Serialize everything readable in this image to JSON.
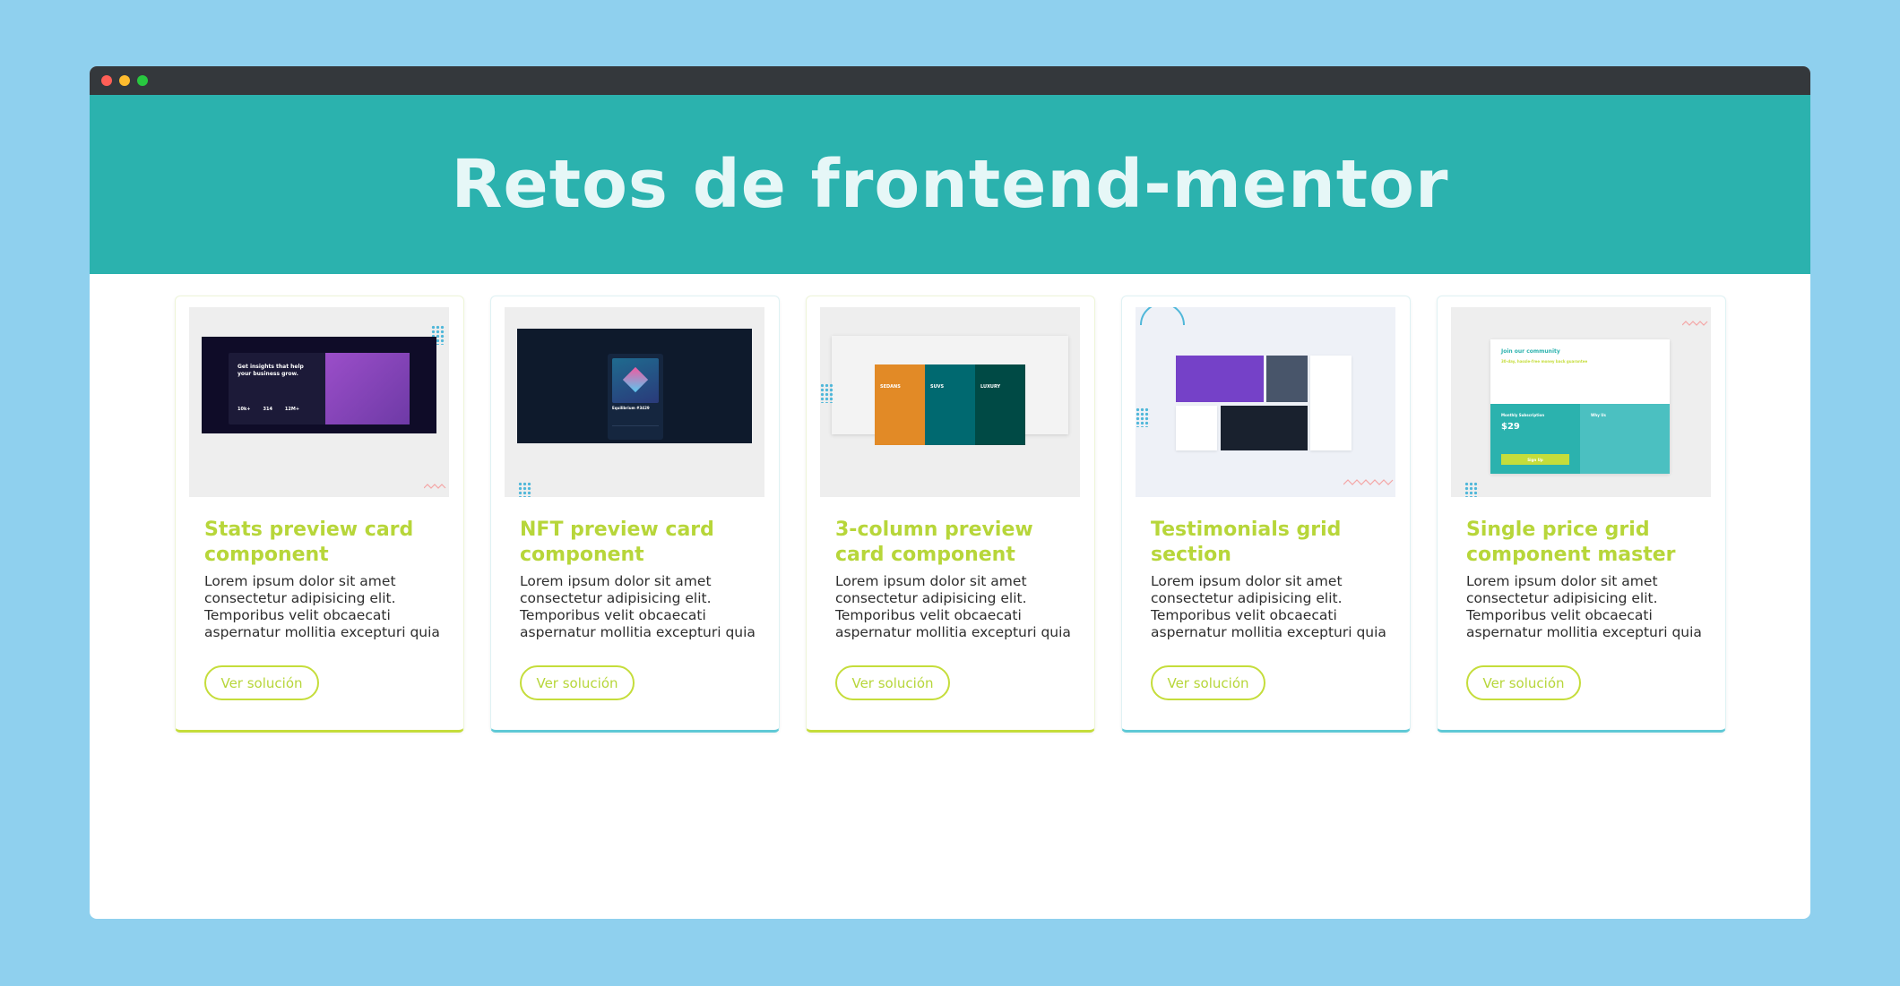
{
  "window": {
    "title_bar": {
      "dots": [
        "close",
        "minimize",
        "maximize"
      ]
    }
  },
  "hero": {
    "title": "Retos de frontend-mentor"
  },
  "cards": [
    {
      "title": "Stats preview card component",
      "description": "Lorem ipsum dolor sit amet consectetur adipisicing elit. Temporibus velit obcaecati aspernatur mollitia excepturi quia",
      "button": "Ver solución",
      "accent": "lime"
    },
    {
      "title": "NFT preview card component",
      "description": "Lorem ipsum dolor sit amet consectetur adipisicing elit. Temporibus velit obcaecati aspernatur mollitia excepturi quia",
      "button": "Ver solución",
      "accent": "teal"
    },
    {
      "title": "3-column preview card component",
      "description": "Lorem ipsum dolor sit amet consectetur adipisicing elit. Temporibus velit obcaecati aspernatur mollitia excepturi quia",
      "button": "Ver solución",
      "accent": "lime"
    },
    {
      "title": "Testimonials grid section",
      "description": "Lorem ipsum dolor sit amet consectetur adipisicing elit. Temporibus velit obcaecati aspernatur mollitia excepturi quia",
      "button": "Ver solución",
      "accent": "teal"
    },
    {
      "title": "Single price grid component master",
      "description": "Lorem ipsum dolor sit amet consectetur adipisicing elit. Temporibus velit obcaecati aspernatur mollitia excepturi quia",
      "button": "Ver solución",
      "accent": "teal"
    }
  ],
  "thumbs": {
    "stats": {
      "heading": "Get insights that help your business grow.",
      "stats": [
        "10k+",
        "314",
        "12M+"
      ]
    },
    "nft": {
      "title": "Equilibrium #3429"
    },
    "three_col": {
      "columns": [
        "SEDANS",
        "SUVS",
        "LUXURY"
      ]
    },
    "pricing": {
      "heading": "Join our community",
      "subheading": "30-day, hassle-free money back guarantee",
      "plan": "Monthly Subscription",
      "price": "$29",
      "why": "Why Us",
      "cta": "Sign Up"
    }
  },
  "colors": {
    "background": "#8fd0ee",
    "hero": "#2bb2ae",
    "accent_lime": "#b7d63a",
    "accent_teal": "#5fc9d6"
  }
}
